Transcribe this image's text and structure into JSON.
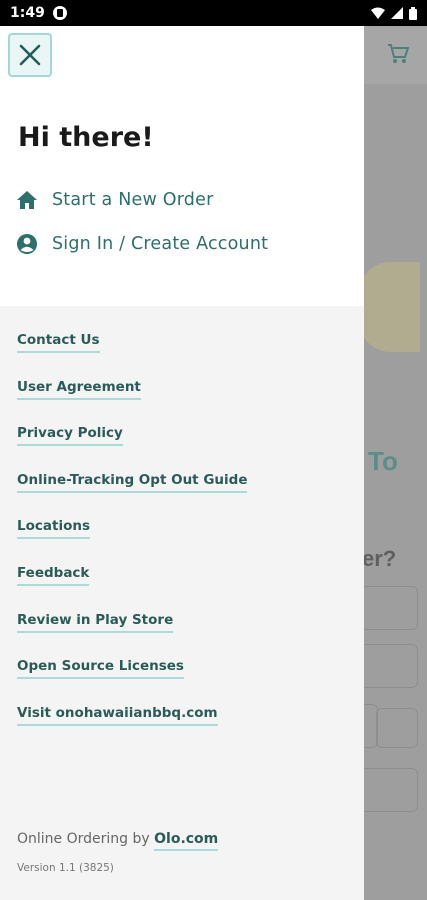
{
  "status_bar": {
    "time": "1:49",
    "icons": [
      "app-notification-icon",
      "wifi-icon",
      "signal-icon",
      "battery-icon"
    ]
  },
  "background_app": {
    "partial_title": "To",
    "partial_question": "er?",
    "cart_icon": "cart-icon",
    "colors": {
      "title": "#5b8d8a"
    }
  },
  "drawer": {
    "close_icon": "close-icon",
    "greeting": "Hi there!",
    "menu": [
      {
        "label": "Start a New Order",
        "icon": "home-icon"
      },
      {
        "label": "Sign In / Create Account",
        "icon": "account-icon"
      }
    ],
    "links": [
      "Contact Us",
      "User Agreement",
      "Privacy Policy",
      "Online-Tracking Opt Out Guide",
      "Locations",
      "Feedback",
      "Review in Play Store",
      "Open Source Licenses",
      "Visit onohawaiianbbq.com"
    ],
    "footer": {
      "prefix": "Online Ordering by ",
      "brand": "Olo.com",
      "version": "Version 1.1 (3825)"
    },
    "colors": {
      "accent": "#2d6f6b",
      "link_underline": "#a9dcd8",
      "close_bg": "#e9f6f5"
    }
  }
}
